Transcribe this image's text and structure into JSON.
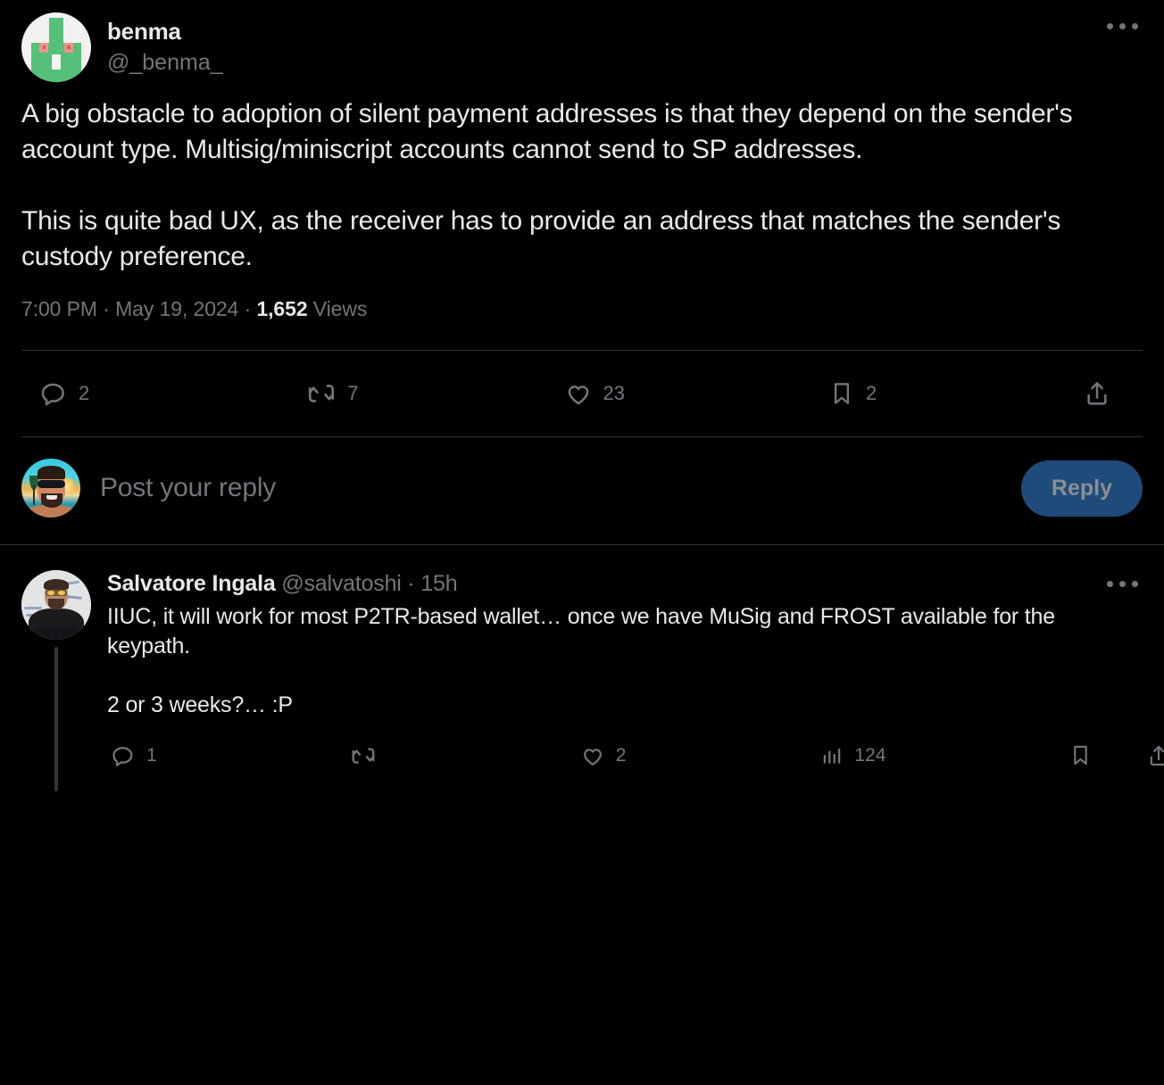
{
  "theme": {
    "background": "#000000",
    "text_primary": "#e7e9ea",
    "text_secondary": "#71767b",
    "divider": "#2f3336",
    "reply_button_bg": "#1e4b7a",
    "reply_button_text": "#8b8f93",
    "thread_line": "#333639"
  },
  "main_tweet": {
    "author": {
      "display_name": "benma",
      "handle": "@_benma_",
      "avatar_name": "benma-avatar"
    },
    "more_label": "…",
    "text": "A big obstacle to adoption of silent payment addresses is that they depend on the sender's account type. Multisig/miniscript accounts cannot send to SP addresses.\n\nThis is quite bad UX, as the receiver has to provide an address that matches the sender's custody preference.",
    "meta": {
      "time": "7:00 PM",
      "separator1": "·",
      "date": "May 19, 2024",
      "separator2": "·",
      "views_count": "1,652",
      "views_label": "Views"
    },
    "actions": [
      {
        "icon": "reply-icon",
        "count": "2"
      },
      {
        "icon": "retweet-icon",
        "count": "7"
      },
      {
        "icon": "like-icon",
        "count": "23"
      },
      {
        "icon": "bookmark-icon",
        "count": "2"
      },
      {
        "icon": "share-icon",
        "count": ""
      }
    ]
  },
  "composer": {
    "avatar_name": "current-user-avatar",
    "placeholder": "Post your reply",
    "reply_button_label": "Reply"
  },
  "reply_tweet": {
    "author": {
      "display_name": "Salvatore Ingala",
      "handle": "@salvatoshi",
      "dot": "·",
      "timestamp": "15h",
      "avatar_name": "salvatore-ingala-avatar"
    },
    "more_label": "…",
    "text": "IIUC, it will work for most P2TR-based wallet… once we have MuSig and FROST available for the keypath.\n\n2 or 3 weeks?… :P",
    "actions": [
      {
        "icon": "reply-icon",
        "count": "1"
      },
      {
        "icon": "retweet-icon",
        "count": ""
      },
      {
        "icon": "like-icon",
        "count": "2"
      },
      {
        "icon": "views-icon",
        "count": "124"
      },
      {
        "icon": "bookmark-icon",
        "count": ""
      },
      {
        "icon": "share-icon",
        "count": ""
      }
    ]
  }
}
